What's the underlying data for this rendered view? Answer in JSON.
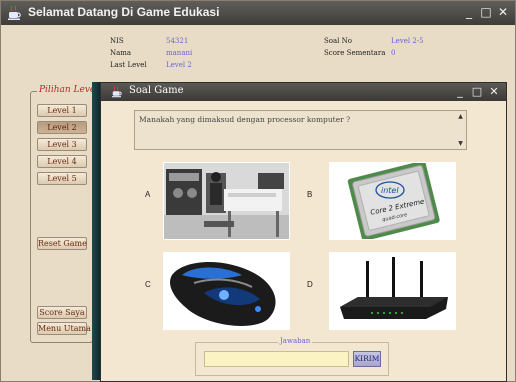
{
  "main_window": {
    "title": "Selamat Datang Di Game Edukasi",
    "controls": {
      "minimize": "_",
      "maximize": "□",
      "close": "✕"
    }
  },
  "info": {
    "nis_label": "NIS",
    "nis_value": "54321",
    "nama_label": "Nama",
    "nama_value": "manani",
    "last_level_label": "Last Level",
    "last_level_value": "Level 2",
    "soal_no_label": "Soal No",
    "soal_no_value": "Level 2-5",
    "score_label": "Score Sementara",
    "score_value": "0"
  },
  "sidebar": {
    "legend": "Pilihan Level",
    "levels": [
      "Level 1",
      "Level 2",
      "Level 3",
      "Level 4",
      "Level 5"
    ],
    "active_level": "Level 2",
    "reset_label": "Reset Game",
    "score_label": "Score Saya",
    "menu_label": "Menu Utama"
  },
  "soal_window": {
    "title": "Soal Game",
    "controls": {
      "minimize": "_",
      "maximize": "□",
      "close": "✕"
    },
    "question": "Manakah yang dimaksud dengan processor komputer ?",
    "options": [
      {
        "letter": "A",
        "image": "vintage-computer-photo"
      },
      {
        "letter": "B",
        "image": "intel-core2-extreme-cpu-photo"
      },
      {
        "letter": "C",
        "image": "gaming-mouse-photo"
      },
      {
        "letter": "D",
        "image": "wireless-router-photo"
      }
    ],
    "answer_legend": "Jawaban",
    "answer_value": "",
    "submit_label": "KIRIM",
    "chip_text_1": "intel",
    "chip_text_2": "Core 2 Extreme",
    "chip_text_3": "quad-core"
  },
  "colors": {
    "accent_value": "#6b62d6",
    "legend_red": "#b5262a",
    "window_bg": "#e9dcc6"
  }
}
